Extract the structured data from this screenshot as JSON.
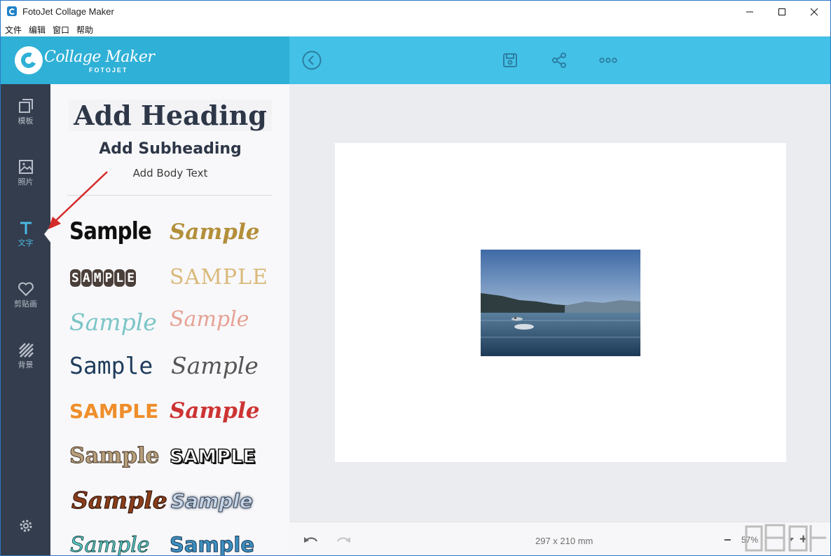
{
  "window": {
    "title": "FotoJet Collage Maker",
    "controls": [
      "minimize",
      "maximize",
      "close"
    ]
  },
  "menubar": {
    "items": [
      "文件",
      "编辑",
      "窗口",
      "帮助"
    ]
  },
  "header": {
    "logo_title": "Collage Maker",
    "logo_sub": "FOTOJET",
    "toolbar": [
      "back-icon",
      "save-icon",
      "share-icon",
      "more-icon"
    ]
  },
  "leftnav": {
    "items": [
      {
        "label": "模板",
        "icon": "template-icon"
      },
      {
        "label": "照片",
        "icon": "photo-icon"
      },
      {
        "label": "文字",
        "icon": "text-icon",
        "active": true
      },
      {
        "label": "剪贴画",
        "icon": "heart-icon"
      },
      {
        "label": "背景",
        "icon": "background-icon"
      }
    ],
    "settings_icon": "gear-icon"
  },
  "text_panel": {
    "heading": "Add Heading",
    "subheading": "Add Subheading",
    "body": "Add Body Text",
    "samples": [
      "Sample",
      "Sample",
      "SAMPLE",
      "SAMPLE",
      "Sample",
      "Sample",
      "Sample",
      "Sample",
      "SAMPLE",
      "Sample",
      "Sample",
      "SAMPLE",
      "Sample",
      "Sample",
      "Sample",
      "Sample"
    ]
  },
  "canvas": {
    "photo": "lake landscape photo"
  },
  "bottombar": {
    "dimensions": "297 x 210 mm",
    "zoom": "57%",
    "minus": "−",
    "plus": "+"
  },
  "colors": {
    "toolbar": "#44c1e6",
    "logo_bg": "#2fb0d6",
    "nav_bg": "#343d4d",
    "accent": "#4ab9e3"
  }
}
